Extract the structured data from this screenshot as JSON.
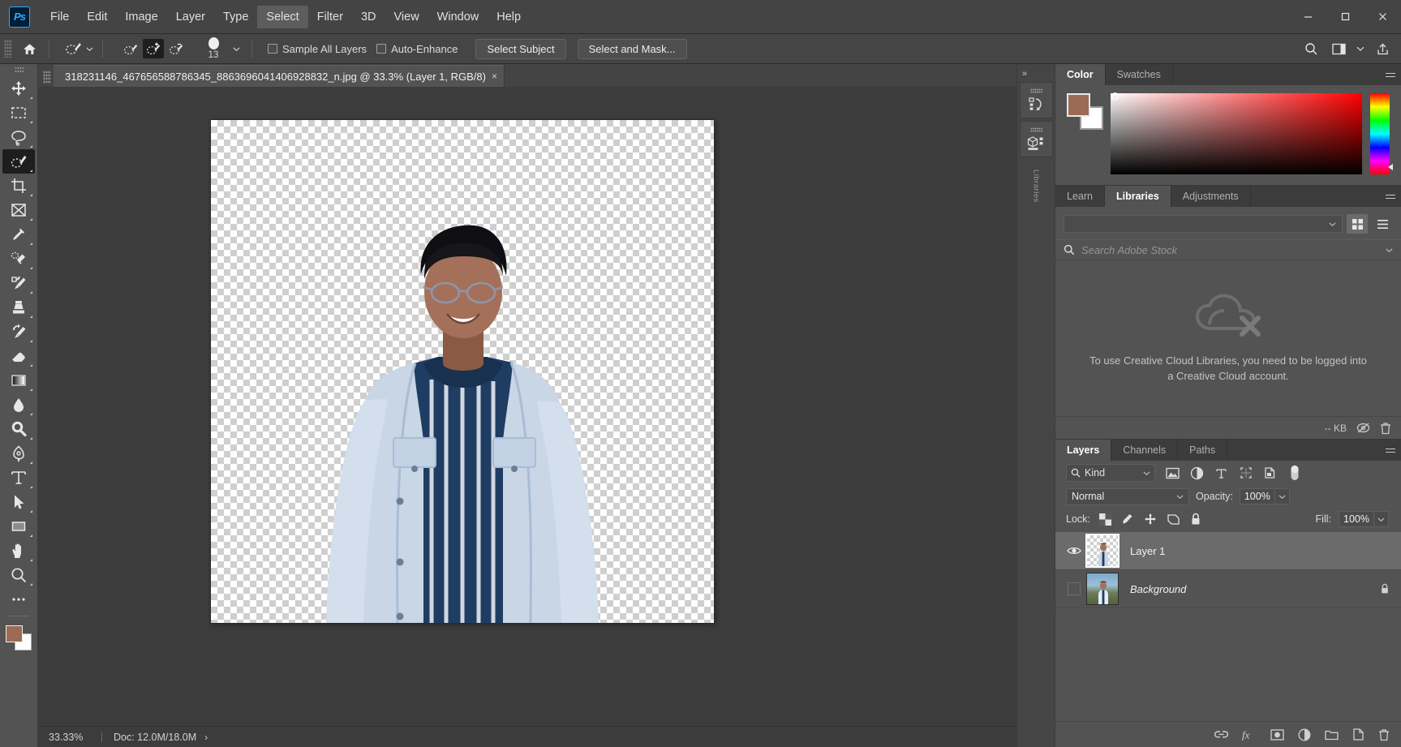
{
  "app": {
    "name": "Adobe Photoshop",
    "logo_text": "Ps"
  },
  "menubar": {
    "items": [
      {
        "label": "File",
        "active": false
      },
      {
        "label": "Edit",
        "active": false
      },
      {
        "label": "Image",
        "active": false
      },
      {
        "label": "Layer",
        "active": false
      },
      {
        "label": "Type",
        "active": false
      },
      {
        "label": "Select",
        "active": true
      },
      {
        "label": "Filter",
        "active": false
      },
      {
        "label": "3D",
        "active": false
      },
      {
        "label": "View",
        "active": false
      },
      {
        "label": "Window",
        "active": false
      },
      {
        "label": "Help",
        "active": false
      }
    ],
    "window_controls": [
      "minimize",
      "maximize",
      "close"
    ]
  },
  "options_bar": {
    "home_icon": "home-icon",
    "tool_preset_icon": "quick-selection-tool-icon",
    "modes": [
      {
        "name": "new-selection",
        "active": false
      },
      {
        "name": "add-to-selection",
        "active": true
      },
      {
        "name": "subtract-from-selection",
        "active": false
      }
    ],
    "brush_size": "13",
    "checkboxes": [
      {
        "label": "Sample All Layers",
        "checked": false
      },
      {
        "label": "Auto-Enhance",
        "checked": false
      }
    ],
    "buttons": [
      {
        "label": "Select Subject"
      },
      {
        "label": "Select and Mask..."
      }
    ],
    "right_icons": [
      "search-icon",
      "workspace-icon",
      "chevron-down-icon",
      "share-icon"
    ]
  },
  "toolbar": {
    "tools": [
      {
        "name": "move-tool",
        "active": false
      },
      {
        "name": "rectangular-marquee-tool",
        "active": false
      },
      {
        "name": "lasso-tool",
        "active": false
      },
      {
        "name": "quick-selection-tool",
        "active": true
      },
      {
        "name": "crop-tool",
        "active": false
      },
      {
        "name": "frame-tool",
        "active": false
      },
      {
        "name": "eyedropper-tool",
        "active": false
      },
      {
        "name": "spot-healing-brush-tool",
        "active": false
      },
      {
        "name": "brush-tool",
        "active": false
      },
      {
        "name": "clone-stamp-tool",
        "active": false
      },
      {
        "name": "history-brush-tool",
        "active": false
      },
      {
        "name": "eraser-tool",
        "active": false
      },
      {
        "name": "gradient-tool",
        "active": false
      },
      {
        "name": "blur-tool",
        "active": false
      },
      {
        "name": "dodge-tool",
        "active": false
      },
      {
        "name": "pen-tool",
        "active": false
      },
      {
        "name": "horizontal-type-tool",
        "active": false
      },
      {
        "name": "path-selection-tool",
        "active": false
      },
      {
        "name": "rectangle-tool",
        "active": false
      },
      {
        "name": "hand-tool",
        "active": false
      },
      {
        "name": "zoom-tool",
        "active": false
      },
      {
        "name": "more-tools",
        "active": false
      }
    ],
    "foreground_color": "#9c6b55",
    "background_color": "#ffffff"
  },
  "document": {
    "tab_title": "318231146_467656588786345_8863696041406928832_n.jpg @ 33.3% (Layer 1, RGB/8)",
    "close_label": "×",
    "canvas": {
      "transparent": true
    }
  },
  "statusbar": {
    "zoom": "33.33%",
    "doc_info": "Doc: 12.0M/18.0M",
    "expand_arrow": "›"
  },
  "rail": {
    "collapse_icon": "chevrons-right-icon",
    "buttons": [
      {
        "name": "history-panel-icon"
      },
      {
        "name": "3d-panel-icon"
      }
    ],
    "vertical_label": "Libraries"
  },
  "color_panel": {
    "tabs": [
      {
        "label": "Color",
        "active": true
      },
      {
        "label": "Swatches",
        "active": false
      }
    ],
    "foreground_color": "#9c6b55",
    "background_color": "#ffffff",
    "menu_icon": "panel-menu-icon"
  },
  "libraries_panel": {
    "tabs": [
      {
        "label": "Learn",
        "active": false
      },
      {
        "label": "Libraries",
        "active": true
      },
      {
        "label": "Adjustments",
        "active": false
      }
    ],
    "library_select_value": "",
    "view_buttons": [
      "grid-view-icon",
      "list-view-icon"
    ],
    "search_placeholder": "Search Adobe Stock",
    "empty_message": "To use Creative Cloud Libraries, you need to be logged into a Creative Cloud account.",
    "footer_size": "-- KB",
    "footer_icons": [
      "sync-off-icon",
      "delete-icon"
    ],
    "menu_icon": "panel-menu-icon"
  },
  "layers_panel": {
    "tabs": [
      {
        "label": "Layers",
        "active": true
      },
      {
        "label": "Channels",
        "active": false
      },
      {
        "label": "Paths",
        "active": false
      }
    ],
    "filter_kind": "Kind",
    "filter_icons": [
      "pixel-filter-icon",
      "adjustment-filter-icon",
      "type-filter-icon",
      "shape-filter-icon",
      "smart-object-filter-icon"
    ],
    "filter_toggle": "filter-toggle-icon",
    "blend_mode": "Normal",
    "opacity_label": "Opacity:",
    "opacity_value": "100%",
    "lock_label": "Lock:",
    "lock_icons": [
      "lock-transparent-pixels-icon",
      "lock-image-pixels-icon",
      "lock-position-icon",
      "lock-artboard-icon",
      "lock-all-icon"
    ],
    "fill_label": "Fill:",
    "fill_value": "100%",
    "layers": [
      {
        "name": "Layer 1",
        "visible": true,
        "selected": true,
        "italic": false,
        "locked": false,
        "thumb": "transparent-cutout"
      },
      {
        "name": "Background",
        "visible": false,
        "selected": false,
        "italic": true,
        "locked": true,
        "thumb": "photo"
      }
    ],
    "footer_icons": [
      "link-layers-icon",
      "layer-style-fx-icon",
      "add-layer-mask-icon",
      "new-adjustment-layer-icon",
      "new-group-icon",
      "new-layer-icon",
      "delete-layer-icon"
    ],
    "menu_icon": "panel-menu-icon"
  }
}
